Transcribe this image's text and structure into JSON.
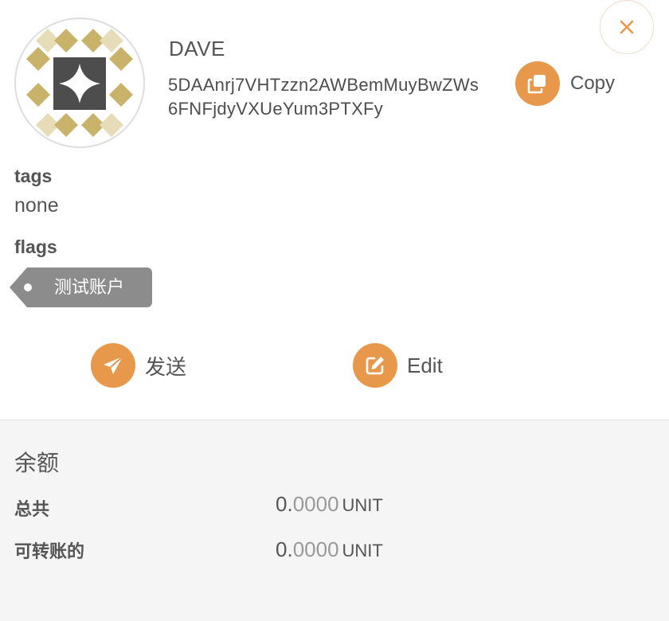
{
  "account": {
    "name": "DAVE",
    "address": "5DAAnrj7VHTzzn2AWBemMuyBwZWs6FNFjdyVXUeYum3PTXFy",
    "copy_label": "Copy"
  },
  "tags": {
    "label": "tags",
    "value": "none"
  },
  "flags": {
    "label": "flags",
    "items": [
      "测试账户"
    ]
  },
  "actions": {
    "send_label": "发送",
    "edit_label": "Edit"
  },
  "balance": {
    "title": "余额",
    "rows": [
      {
        "label": "总共",
        "integer": "0.",
        "decimals": "0000",
        "unit": "UNIT"
      },
      {
        "label": "可转账的",
        "integer": "0.",
        "decimals": "0000",
        "unit": "UNIT"
      }
    ]
  },
  "colors": {
    "accent": "#e8984a",
    "flag_bg": "#8c8c8c",
    "avatar_gold": "#c9b36b",
    "avatar_light": "#e6dcb8",
    "avatar_dark": "#4d4d4d"
  },
  "icons": [
    "close-icon",
    "copy-icon",
    "send-icon",
    "edit-icon",
    "identicon"
  ]
}
